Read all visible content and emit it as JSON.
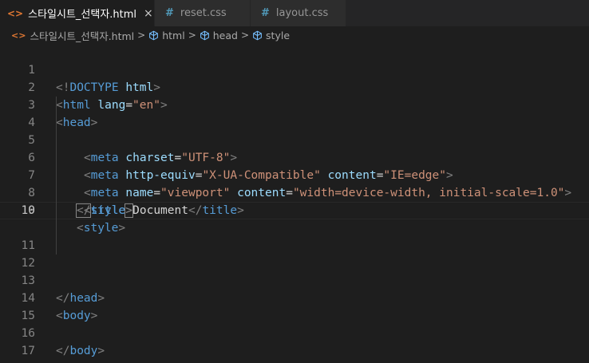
{
  "tabs": [
    {
      "icon": "<>",
      "label": "스타일시트_선택자.html",
      "active": true,
      "close": "×"
    },
    {
      "icon": "#",
      "label": "reset.css",
      "active": false
    },
    {
      "icon": "#",
      "label": "layout.css",
      "active": false
    }
  ],
  "breadcrumb": {
    "file_icon": "<>",
    "file": "스타일시트_선택자.html",
    "items": [
      "html",
      "head",
      "style"
    ],
    "separator": ">"
  },
  "editor": {
    "current_line": 10,
    "line_numbers": [
      "1",
      "2",
      "3",
      "4",
      "5",
      "6",
      "7",
      "8",
      "9",
      "10",
      "11",
      "12",
      "13",
      "14",
      "15",
      "16",
      "17"
    ],
    "lines": {
      "l1": {
        "open": "<!",
        "doctype": "DOCTYPE",
        "sp": " ",
        "html": "html",
        "close": ">"
      },
      "l2": {
        "open": "<",
        "tag": "html",
        "sp": " ",
        "attr": "lang",
        "eq": "=",
        "val": "\"en\"",
        "close": ">"
      },
      "l3": {
        "open": "<",
        "tag": "head",
        "close": ">"
      },
      "l4": {
        "open": "<",
        "tag": "meta",
        "sp": " ",
        "attr": "charset",
        "eq": "=",
        "val": "\"UTF-8\"",
        "close": ">"
      },
      "l5": {
        "open": "<",
        "tag": "meta",
        "sp1": " ",
        "attr1": "http-equiv",
        "eq1": "=",
        "val1": "\"X-UA-Compatible\"",
        "sp2": " ",
        "attr2": "content",
        "eq2": "=",
        "val2": "\"IE=edge\"",
        "close": ">"
      },
      "l6": {
        "open": "<",
        "tag": "meta",
        "sp1": " ",
        "attr1": "name",
        "eq1": "=",
        "val1": "\"viewport\"",
        "sp2": " ",
        "attr2": "content",
        "eq2": "=",
        "val2": "\"width=device-width, initial-scale=1.0\"",
        "close": ">"
      },
      "l7": {
        "open": "<",
        "tag": "title",
        "close": ">",
        "text": "Document",
        "open2": "</",
        "tag2": "title",
        "close2": ">"
      },
      "l8": {
        "open": "<",
        "tag": "style",
        "close": ">"
      },
      "l10": {
        "open": "</",
        "tag": "style",
        "close": ">"
      },
      "l13": {
        "open": "</",
        "tag": "head",
        "close": ">"
      },
      "l14": {
        "open": "<",
        "tag": "body",
        "close": ">"
      },
      "l16": {
        "open": "</",
        "tag": "body",
        "close": ">"
      },
      "l17": {
        "open": "</",
        "tag": "html",
        "close": ">"
      }
    }
  },
  "colors": {
    "background": "#1e1e1e",
    "tab_active": "#1e1e1e",
    "tab_inactive": "#2d2d2d",
    "html_icon": "#e37933",
    "css_icon": "#519aba",
    "tag": "#569cd6",
    "attribute": "#9cdcfe",
    "string": "#ce9178",
    "bracket": "#808080"
  }
}
